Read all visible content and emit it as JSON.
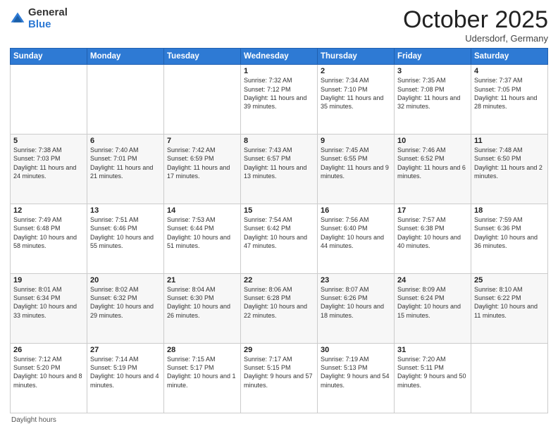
{
  "header": {
    "logo_general": "General",
    "logo_blue": "Blue",
    "month": "October 2025",
    "location": "Udersdorf, Germany"
  },
  "days_of_week": [
    "Sunday",
    "Monday",
    "Tuesday",
    "Wednesday",
    "Thursday",
    "Friday",
    "Saturday"
  ],
  "weeks": [
    [
      {
        "day": "",
        "detail": ""
      },
      {
        "day": "",
        "detail": ""
      },
      {
        "day": "",
        "detail": ""
      },
      {
        "day": "1",
        "detail": "Sunrise: 7:32 AM\nSunset: 7:12 PM\nDaylight: 11 hours\nand 39 minutes."
      },
      {
        "day": "2",
        "detail": "Sunrise: 7:34 AM\nSunset: 7:10 PM\nDaylight: 11 hours\nand 35 minutes."
      },
      {
        "day": "3",
        "detail": "Sunrise: 7:35 AM\nSunset: 7:08 PM\nDaylight: 11 hours\nand 32 minutes."
      },
      {
        "day": "4",
        "detail": "Sunrise: 7:37 AM\nSunset: 7:05 PM\nDaylight: 11 hours\nand 28 minutes."
      }
    ],
    [
      {
        "day": "5",
        "detail": "Sunrise: 7:38 AM\nSunset: 7:03 PM\nDaylight: 11 hours\nand 24 minutes."
      },
      {
        "day": "6",
        "detail": "Sunrise: 7:40 AM\nSunset: 7:01 PM\nDaylight: 11 hours\nand 21 minutes."
      },
      {
        "day": "7",
        "detail": "Sunrise: 7:42 AM\nSunset: 6:59 PM\nDaylight: 11 hours\nand 17 minutes."
      },
      {
        "day": "8",
        "detail": "Sunrise: 7:43 AM\nSunset: 6:57 PM\nDaylight: 11 hours\nand 13 minutes."
      },
      {
        "day": "9",
        "detail": "Sunrise: 7:45 AM\nSunset: 6:55 PM\nDaylight: 11 hours\nand 9 minutes."
      },
      {
        "day": "10",
        "detail": "Sunrise: 7:46 AM\nSunset: 6:52 PM\nDaylight: 11 hours\nand 6 minutes."
      },
      {
        "day": "11",
        "detail": "Sunrise: 7:48 AM\nSunset: 6:50 PM\nDaylight: 11 hours\nand 2 minutes."
      }
    ],
    [
      {
        "day": "12",
        "detail": "Sunrise: 7:49 AM\nSunset: 6:48 PM\nDaylight: 10 hours\nand 58 minutes."
      },
      {
        "day": "13",
        "detail": "Sunrise: 7:51 AM\nSunset: 6:46 PM\nDaylight: 10 hours\nand 55 minutes."
      },
      {
        "day": "14",
        "detail": "Sunrise: 7:53 AM\nSunset: 6:44 PM\nDaylight: 10 hours\nand 51 minutes."
      },
      {
        "day": "15",
        "detail": "Sunrise: 7:54 AM\nSunset: 6:42 PM\nDaylight: 10 hours\nand 47 minutes."
      },
      {
        "day": "16",
        "detail": "Sunrise: 7:56 AM\nSunset: 6:40 PM\nDaylight: 10 hours\nand 44 minutes."
      },
      {
        "day": "17",
        "detail": "Sunrise: 7:57 AM\nSunset: 6:38 PM\nDaylight: 10 hours\nand 40 minutes."
      },
      {
        "day": "18",
        "detail": "Sunrise: 7:59 AM\nSunset: 6:36 PM\nDaylight: 10 hours\nand 36 minutes."
      }
    ],
    [
      {
        "day": "19",
        "detail": "Sunrise: 8:01 AM\nSunset: 6:34 PM\nDaylight: 10 hours\nand 33 minutes."
      },
      {
        "day": "20",
        "detail": "Sunrise: 8:02 AM\nSunset: 6:32 PM\nDaylight: 10 hours\nand 29 minutes."
      },
      {
        "day": "21",
        "detail": "Sunrise: 8:04 AM\nSunset: 6:30 PM\nDaylight: 10 hours\nand 26 minutes."
      },
      {
        "day": "22",
        "detail": "Sunrise: 8:06 AM\nSunset: 6:28 PM\nDaylight: 10 hours\nand 22 minutes."
      },
      {
        "day": "23",
        "detail": "Sunrise: 8:07 AM\nSunset: 6:26 PM\nDaylight: 10 hours\nand 18 minutes."
      },
      {
        "day": "24",
        "detail": "Sunrise: 8:09 AM\nSunset: 6:24 PM\nDaylight: 10 hours\nand 15 minutes."
      },
      {
        "day": "25",
        "detail": "Sunrise: 8:10 AM\nSunset: 6:22 PM\nDaylight: 10 hours\nand 11 minutes."
      }
    ],
    [
      {
        "day": "26",
        "detail": "Sunrise: 7:12 AM\nSunset: 5:20 PM\nDaylight: 10 hours\nand 8 minutes."
      },
      {
        "day": "27",
        "detail": "Sunrise: 7:14 AM\nSunset: 5:19 PM\nDaylight: 10 hours\nand 4 minutes."
      },
      {
        "day": "28",
        "detail": "Sunrise: 7:15 AM\nSunset: 5:17 PM\nDaylight: 10 hours\nand 1 minute."
      },
      {
        "day": "29",
        "detail": "Sunrise: 7:17 AM\nSunset: 5:15 PM\nDaylight: 9 hours\nand 57 minutes."
      },
      {
        "day": "30",
        "detail": "Sunrise: 7:19 AM\nSunset: 5:13 PM\nDaylight: 9 hours\nand 54 minutes."
      },
      {
        "day": "31",
        "detail": "Sunrise: 7:20 AM\nSunset: 5:11 PM\nDaylight: 9 hours\nand 50 minutes."
      },
      {
        "day": "",
        "detail": ""
      }
    ]
  ],
  "footer": {
    "note": "Daylight hours"
  }
}
